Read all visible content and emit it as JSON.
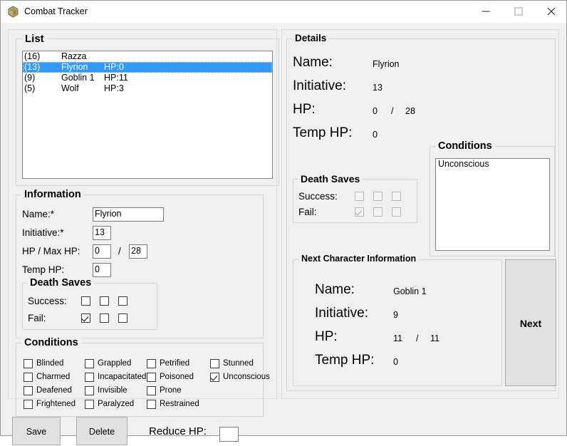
{
  "window": {
    "title": "Combat Tracker",
    "icon": "d20-die-icon",
    "controls": {
      "minimize": "minimize-icon",
      "maximize": "maximize-icon",
      "close": "close-icon"
    }
  },
  "colors": {
    "window_background": "#f0f0f0",
    "titlebar_background": "#ffffff",
    "selection_blue": "#3399ff",
    "field_background": "#ffffff",
    "button_face": "#e1e1e1",
    "icon_gold": "#8a7d46"
  },
  "list": {
    "legend": "List",
    "rows": [
      {
        "initiative": "(16)",
        "name": "Razza",
        "hp": "",
        "selected": false
      },
      {
        "initiative": "(13)",
        "name": "Flyrion",
        "hp": "HP:0",
        "selected": true
      },
      {
        "initiative": "(9)",
        "name": "Goblin 1",
        "hp": "HP:11",
        "selected": false
      },
      {
        "initiative": "(5)",
        "name": "Wolf",
        "hp": "HP:3",
        "selected": false
      }
    ]
  },
  "information": {
    "legend": "Information",
    "name_label": "Name:*",
    "name_value": "Flyrion",
    "initiative_label": "Initiative:*",
    "initiative_value": "13",
    "hp_label": "HP / Max HP:",
    "hp_value": "0",
    "separator": "/",
    "max_hp_value": "28",
    "temp_hp_label": "Temp HP:",
    "temp_hp_value": "0",
    "death_saves": {
      "legend": "Death Saves",
      "success_label": "Success:",
      "success_checked": [
        false,
        false,
        false
      ],
      "fail_label": "Fail:",
      "fail_checked": [
        true,
        false,
        false
      ]
    }
  },
  "conditions_edit": {
    "legend": "Conditions",
    "items": [
      {
        "label": "Blinded",
        "checked": false,
        "col": 0,
        "row": 0
      },
      {
        "label": "Charmed",
        "checked": false,
        "col": 0,
        "row": 1
      },
      {
        "label": "Deafened",
        "checked": false,
        "col": 0,
        "row": 2
      },
      {
        "label": "Frightened",
        "checked": false,
        "col": 0,
        "row": 3
      },
      {
        "label": "Grappled",
        "checked": false,
        "col": 1,
        "row": 0
      },
      {
        "label": "Incapacitated",
        "checked": false,
        "col": 1,
        "row": 1
      },
      {
        "label": "Invisible",
        "checked": false,
        "col": 1,
        "row": 2
      },
      {
        "label": "Paralyzed",
        "checked": false,
        "col": 1,
        "row": 3
      },
      {
        "label": "Petrified",
        "checked": false,
        "col": 2,
        "row": 0
      },
      {
        "label": "Poisoned",
        "checked": false,
        "col": 2,
        "row": 1
      },
      {
        "label": "Prone",
        "checked": false,
        "col": 2,
        "row": 2
      },
      {
        "label": "Restrained",
        "checked": false,
        "col": 2,
        "row": 3
      },
      {
        "label": "Stunned",
        "checked": false,
        "col": 3,
        "row": 0
      },
      {
        "label": "Unconscious",
        "checked": true,
        "col": 3,
        "row": 1
      }
    ]
  },
  "details": {
    "legend": "Details",
    "name_label": "Name:",
    "name_value": "Flyrion",
    "initiative_label": "Initiative:",
    "initiative_value": "13",
    "hp_label": "HP:",
    "hp_value": "0",
    "separator": "/",
    "max_hp_value": "28",
    "temp_hp_label": "Temp HP:",
    "temp_hp_value": "0",
    "death_saves": {
      "legend": "Death Saves",
      "success_label": "Success:",
      "success_checked": [
        false,
        false,
        false
      ],
      "fail_label": "Fail:",
      "fail_checked": [
        true,
        false,
        false
      ]
    },
    "conditions": {
      "legend": "Conditions",
      "items": [
        "Unconscious"
      ]
    }
  },
  "next_character": {
    "legend": "Next Character Information",
    "name_label": "Name:",
    "name_value": "Goblin 1",
    "initiative_label": "Initiative:",
    "initiative_value": "9",
    "hp_label": "HP:",
    "hp_value": "11",
    "separator": "/",
    "max_hp_value": "11",
    "temp_hp_label": "Temp HP:",
    "temp_hp_value": "0",
    "next_button_label": "Next"
  },
  "footer": {
    "save_label": "Save",
    "delete_label": "Delete",
    "reduce_hp_label": "Reduce HP:",
    "reduce_hp_value": "",
    "reduce_hp_placeholder": ""
  }
}
